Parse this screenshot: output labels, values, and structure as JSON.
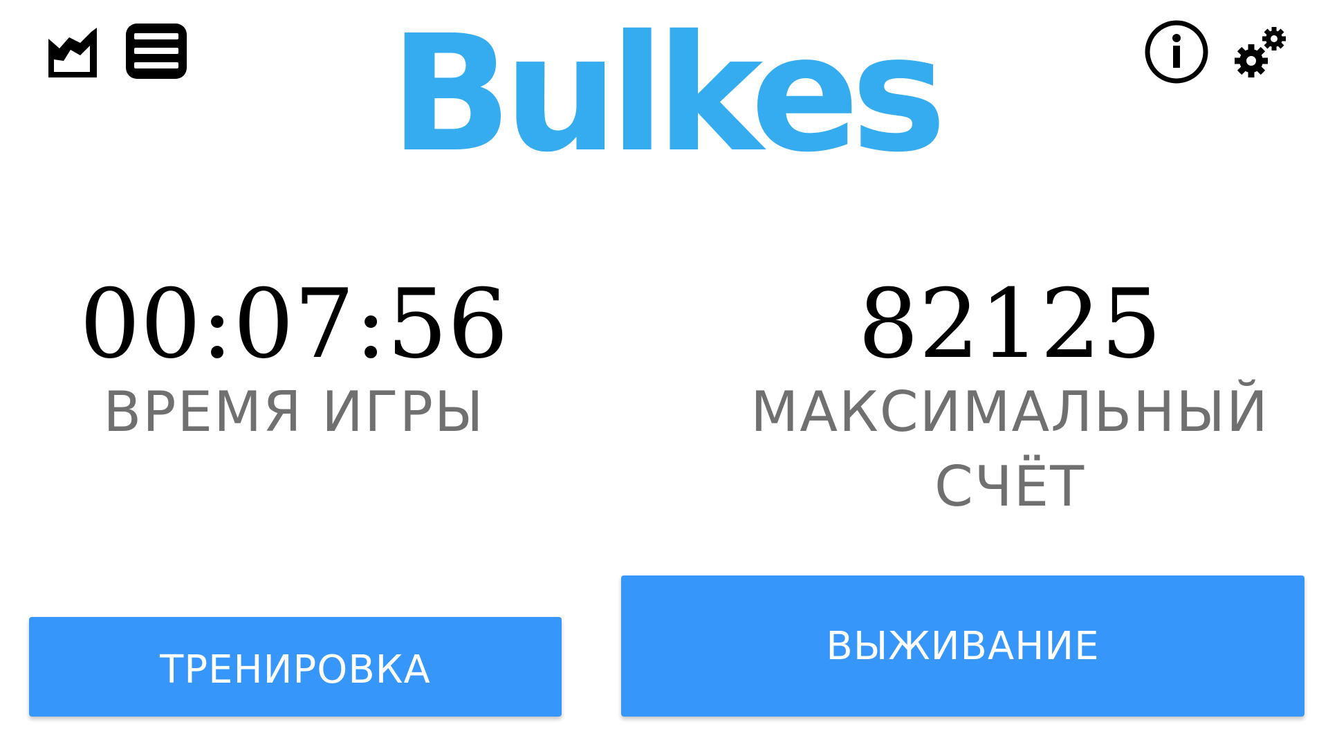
{
  "app": {
    "title": "Bulkes"
  },
  "toolbar": {
    "left_icons": [
      "chart-icon",
      "menu-icon"
    ],
    "right_icons": [
      "info-icon",
      "settings-icon"
    ]
  },
  "stats": {
    "time": {
      "value": "00:07:56",
      "label": "ВРЕМЯ ИГРЫ"
    },
    "score": {
      "value": "82125",
      "label_line1": "МАКСИМАЛЬНЫЙ",
      "label_line2": "СЧЁТ"
    }
  },
  "buttons": {
    "training": "ТРЕНИРОВКА",
    "survival": "ВЫЖИВАНИЕ"
  },
  "colors": {
    "logo": "#34acef",
    "button": "#3796fa",
    "label": "#707070"
  }
}
